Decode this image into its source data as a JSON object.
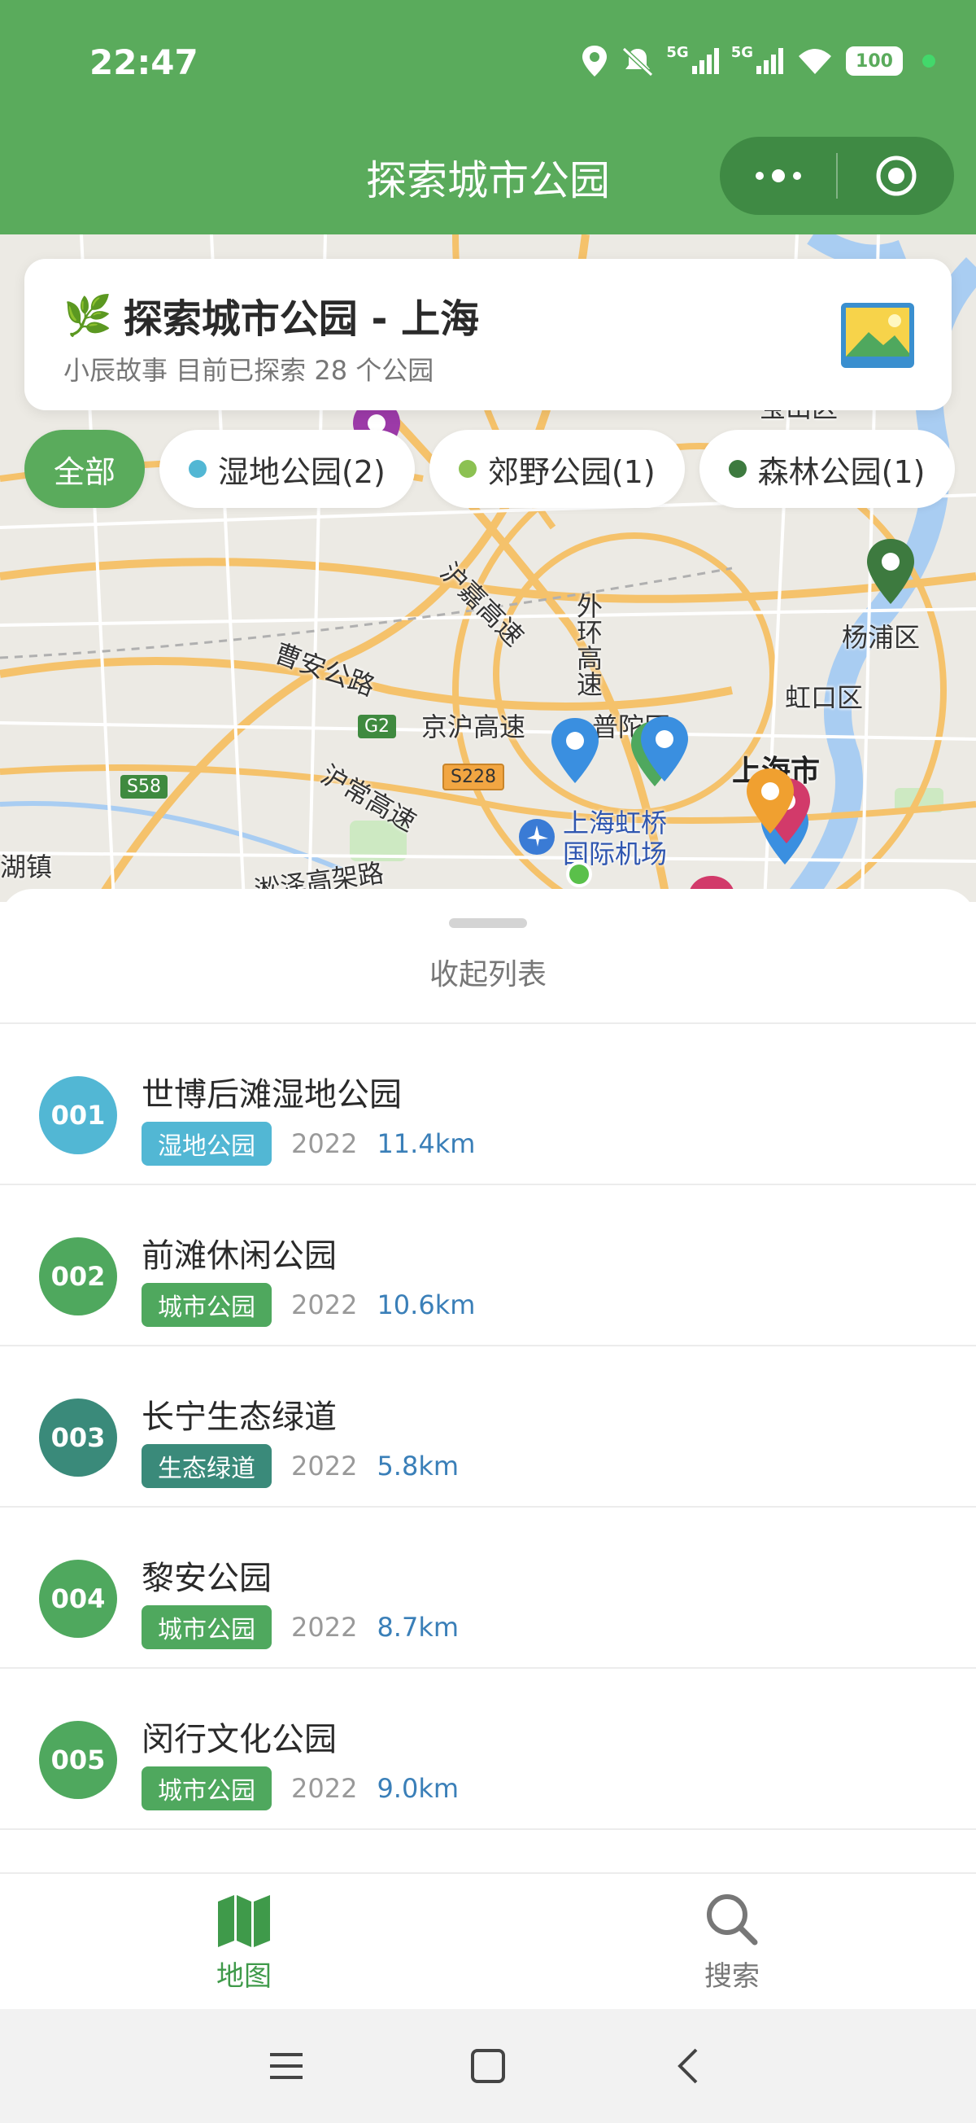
{
  "status_bar": {
    "time": "22:47",
    "battery": "100",
    "signal_1": "5G",
    "signal_2": "5G",
    "icons": [
      "location-icon",
      "mute-icon",
      "signal-icon",
      "signal-icon",
      "wifi-icon",
      "battery-icon"
    ]
  },
  "nav": {
    "title": "探索城市公园",
    "more_icon": "more-dots-icon",
    "close_icon": "target-icon"
  },
  "info_card": {
    "emoji": "🌿",
    "title": "探索城市公园 - 上海",
    "subtitle": "小辰故事 目前已探索 28 个公园"
  },
  "filters": [
    {
      "label": "全部",
      "active": true
    },
    {
      "label": "湿地公园(2)",
      "dot_color": "#52b7d4"
    },
    {
      "label": "郊野公园(1)",
      "dot_color": "#8cc152"
    },
    {
      "label": "森林公园(1)",
      "dot_color": "#3d7a3f"
    }
  ],
  "map": {
    "labels": {
      "yangpu": "杨浦区",
      "hongkou": "虹口区",
      "shanghai": "上海市",
      "putuo": "普陀区",
      "hongqiao": "上海虹桥",
      "hongqiao2": "国际机场",
      "caoan": "曹安公路",
      "jinghu": "京沪高速",
      "huchang": "沪常高速",
      "hujia": "沪嘉高速",
      "waihuan": "外环高速",
      "songze": "淞泽高架路",
      "huzhen": "湖镇",
      "baoshan": "宝山区",
      "g2": "G2",
      "s58": "S58",
      "s228": "S228"
    }
  },
  "sheet": {
    "collapse_label": "收起列表",
    "items": [
      {
        "num": "001",
        "name": "世博后滩湿地公园",
        "tag": "湿地公园",
        "year": "2022",
        "dist": "11.4km",
        "color": "#52b7d4"
      },
      {
        "num": "002",
        "name": "前滩休闲公园",
        "tag": "城市公园",
        "year": "2022",
        "dist": "10.6km",
        "color": "#4fa85e"
      },
      {
        "num": "003",
        "name": "长宁生态绿道",
        "tag": "生态绿道",
        "year": "2022",
        "dist": "5.8km",
        "color": "#3a8a7a"
      },
      {
        "num": "004",
        "name": "黎安公园",
        "tag": "城市公园",
        "year": "2022",
        "dist": "8.7km",
        "color": "#4fa85e"
      },
      {
        "num": "005",
        "name": "闵行文化公园",
        "tag": "城市公园",
        "year": "2022",
        "dist": "9.0km",
        "color": "#4fa85e"
      }
    ]
  },
  "tabs": [
    {
      "label": "地图",
      "icon": "map-icon",
      "active": true
    },
    {
      "label": "搜索",
      "icon": "search-icon",
      "active": false
    }
  ],
  "system_nav": [
    "menu-icon",
    "home-icon",
    "back-icon"
  ]
}
